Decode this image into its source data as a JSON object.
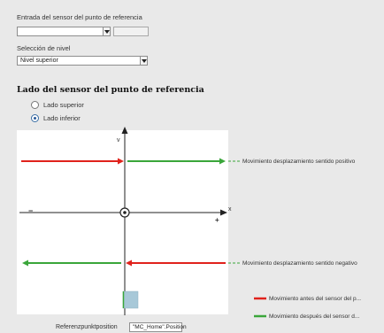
{
  "sensor_input": {
    "label": "Entrada del sensor del punto de referencia",
    "value": ""
  },
  "level_select": {
    "label": "Selección de nivel",
    "value": "Nivel superior"
  },
  "section": {
    "title": "Lado del sensor del punto de referencia",
    "options": [
      {
        "label": "Lado superior",
        "checked": false
      },
      {
        "label": "Lado inferior",
        "checked": true
      }
    ]
  },
  "diagram": {
    "y_axis": "v",
    "x_axis": "x",
    "minus": "−",
    "plus": "+",
    "annotations": {
      "positive": "Movimiento desplazamiento sentido positivo",
      "negative": "Movimiento desplazamiento sentido negativo"
    },
    "legend": {
      "before": "Movimiento antes del sensor del p...",
      "after": "Movimiento después del sensor d..."
    },
    "colors": {
      "before": "#e0221c",
      "after": "#3aa63a",
      "axis": "#222222",
      "marker": "#a7c8d8"
    }
  },
  "position_field": {
    "label": "Referenzpunktposition",
    "value": "\"MC_Home\".Position"
  }
}
